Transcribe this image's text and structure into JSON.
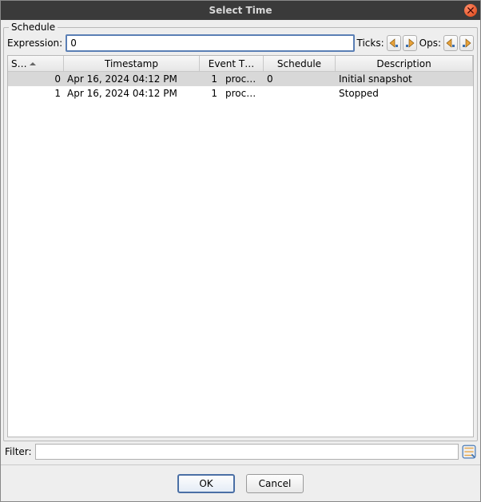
{
  "window": {
    "title": "Select Time"
  },
  "group": {
    "label": "Schedule"
  },
  "expression": {
    "label": "Expression:",
    "value": "0",
    "ticks_label": "Ticks:",
    "ops_label": "Ops:"
  },
  "icons": {
    "step_back": "step-back-icon",
    "step_fwd": "step-forward-icon",
    "filter": "filter-icon",
    "close": "close-icon",
    "sort": "sort-asc-icon"
  },
  "columns": {
    "snap": "S…",
    "timestamp": "Timestamp",
    "event_thread": "Event T…",
    "schedule": "Schedule",
    "description": "Description"
  },
  "rows": [
    {
      "snap": "0",
      "timestamp": "Apr 16, 2024 04:12 PM",
      "evt_num": "1",
      "evt_txt": "proc…",
      "schedule": "0",
      "description": "Initial snapshot",
      "selected": true
    },
    {
      "snap": "1",
      "timestamp": "Apr 16, 2024 04:12 PM",
      "evt_num": "1",
      "evt_txt": "proc…",
      "schedule": "",
      "description": "Stopped",
      "selected": false
    }
  ],
  "filter": {
    "label": "Filter:",
    "value": ""
  },
  "buttons": {
    "ok": "OK",
    "cancel": "Cancel"
  }
}
